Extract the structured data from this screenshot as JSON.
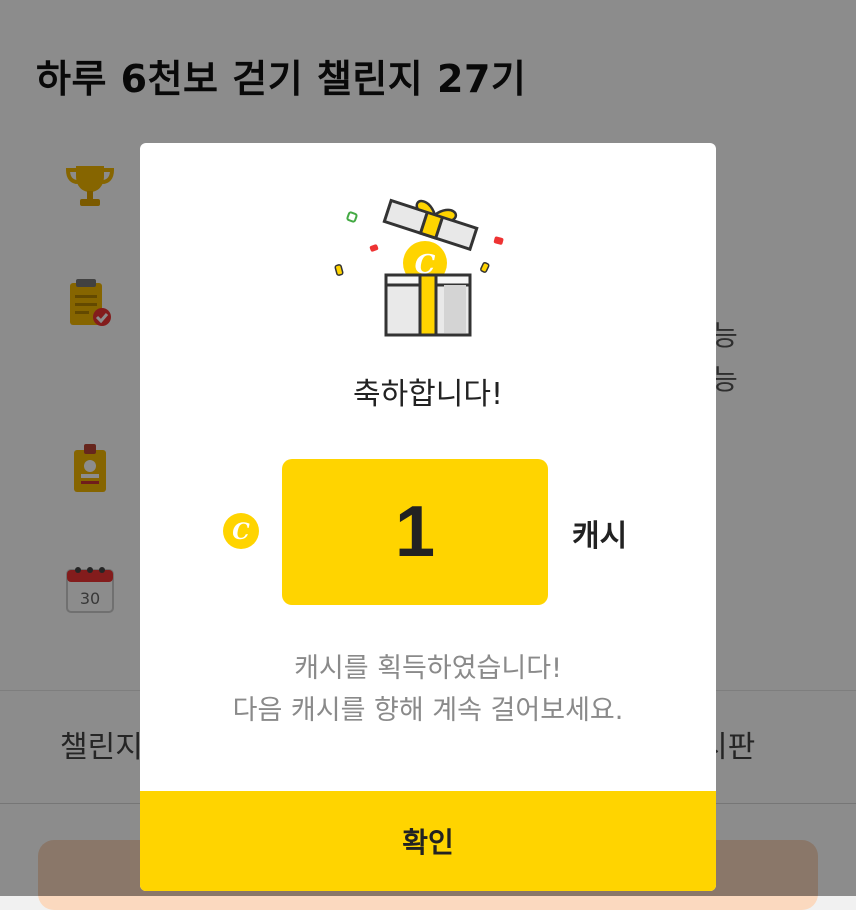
{
  "background": {
    "title": "하루 6천보 걷기 챌린지 27기",
    "side_texts": [
      "능",
      "능"
    ],
    "calendar_day": "30",
    "tab_left": "챌린지",
    "tab_right": "시판",
    "icons": [
      "trophy-icon",
      "checklist-icon",
      "badge-icon",
      "calendar-icon"
    ]
  },
  "modal": {
    "congrats": "축하합니다!",
    "coin_symbol": "C",
    "amount": "1",
    "unit": "캐시",
    "message_line1": "캐시를 획득하였습니다!",
    "message_line2": "다음 캐시를 향해 계속 걸어보세요.",
    "confirm_label": "확인"
  },
  "colors": {
    "accent": "#ffd400",
    "overlay": "rgba(0,0,0,0.45)",
    "muted_text": "#8a8a8a"
  }
}
